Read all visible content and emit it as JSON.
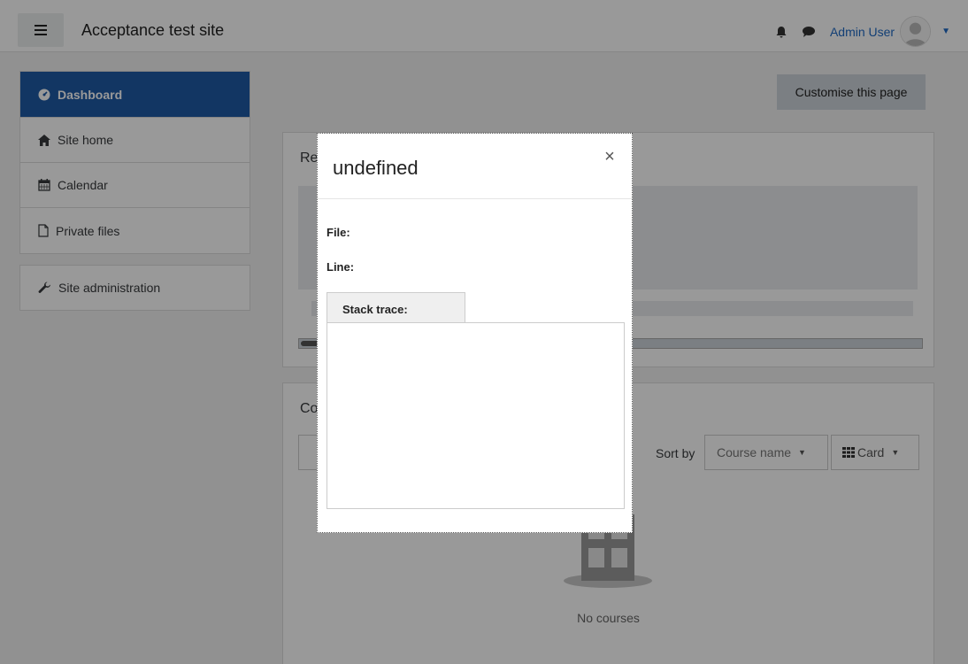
{
  "navbar": {
    "site_name": "Acceptance test site",
    "user_name": "Admin User"
  },
  "sidebar": {
    "items": [
      {
        "label": "Dashboard",
        "icon": "tachometer-icon"
      },
      {
        "label": "Site home",
        "icon": "home-icon"
      },
      {
        "label": "Calendar",
        "icon": "calendar-icon"
      },
      {
        "label": "Private files",
        "icon": "file-icon"
      }
    ],
    "admin": {
      "label": "Site administration",
      "icon": "wrench-icon"
    }
  },
  "main": {
    "customise_label": "Customise this page",
    "recent_title": "Re",
    "courses_title": "Co",
    "sort_label": "Sort by",
    "sort_value": "Course name",
    "view_value": "Card",
    "no_courses": "No courses"
  },
  "modal": {
    "title": "undefined",
    "close_glyph": "×",
    "file_label": "File:",
    "line_label": "Line:",
    "stack_label": "Stack trace:"
  },
  "colors": {
    "accent": "#1f5aa6",
    "link": "#1e69c4"
  }
}
